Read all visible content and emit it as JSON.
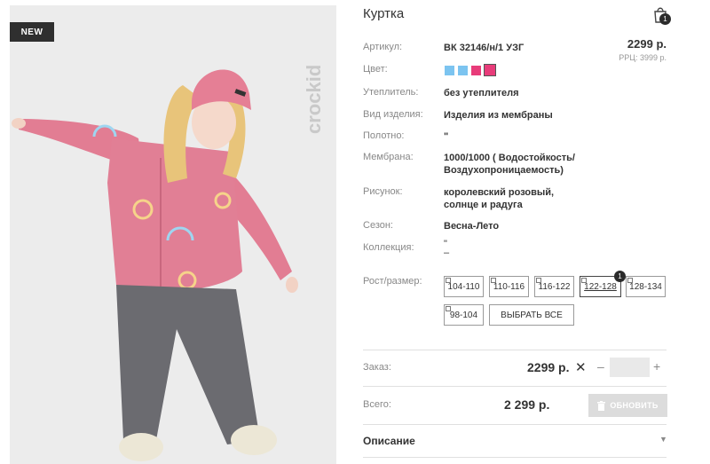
{
  "product": {
    "badge": "NEW",
    "title": "Куртка",
    "brand_watermark": "crockid"
  },
  "cart": {
    "count": "1"
  },
  "price": {
    "main": "2299 р.",
    "rrp": "РРЦ: 3999 р."
  },
  "specs": [
    {
      "label": "Артикул:",
      "value": "ВК 32146/н/1 УЗГ"
    },
    {
      "label": "Цвет:",
      "value": ""
    },
    {
      "label": "Утеплитель:",
      "value": "без утеплителя"
    },
    {
      "label": "Вид изделия:",
      "value": "Изделия из мембраны"
    },
    {
      "label": "Полотно:",
      "value": "\""
    },
    {
      "label": "Мембрана:",
      "value_line1": "1000/1000 ( Водостойкость/",
      "value_line2": "Воздухопроницаемость)"
    },
    {
      "label": "Рисунок:",
      "value_line1": "королевский розовый,",
      "value_line2": "солнце и радуга"
    },
    {
      "label": "Сезон:",
      "value": "Весна-Лето"
    },
    {
      "label": "Коллекция:",
      "value_line1": "\"",
      "value_line2": "–"
    },
    {
      "label": "Рост/размер:"
    }
  ],
  "colors": [
    "#7cc4f0",
    "#7cc4f0",
    "#e83c7a",
    "#e83c7a"
  ],
  "sizes": [
    "104-110",
    "110-116",
    "116-122",
    "122-128",
    "128-134",
    "98-104"
  ],
  "selected_size_count": "1",
  "select_all_label": "ВЫБРАТЬ ВСЕ",
  "order": {
    "label": "Заказ:",
    "price": "2299 р.",
    "x": "✕",
    "minus": "–",
    "plus": "+"
  },
  "total": {
    "label": "Всего:",
    "value": "2 299 р.",
    "button": "ОБНОВИТЬ"
  },
  "description": {
    "label": "Описание"
  }
}
